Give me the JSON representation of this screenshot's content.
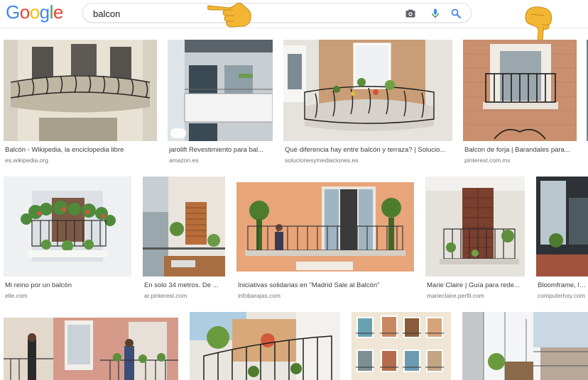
{
  "header": {
    "logo_letters": [
      {
        "ch": "G",
        "color": "#4285F4"
      },
      {
        "ch": "o",
        "color": "#EA4335"
      },
      {
        "ch": "o",
        "color": "#FBBC05"
      },
      {
        "ch": "g",
        "color": "#4285F4"
      },
      {
        "ch": "l",
        "color": "#34A853"
      },
      {
        "ch": "e",
        "color": "#EA4335"
      }
    ],
    "search": {
      "value": "balcon"
    },
    "icons": [
      "camera-icon",
      "microphone-icon",
      "search-icon"
    ]
  },
  "results": [
    {
      "title": "Balcón - Wikipedia, la enciclopedia libre",
      "site": "es.wikipedia.org"
    },
    {
      "title": "jarolift Revestimiento para bal...",
      "site": "amazon.es"
    },
    {
      "title": "Qué diferencia hay entre balcón y terraza? | Solucio...",
      "site": "solucionesymediaciones.es"
    },
    {
      "title": "Balcon de forja | Barandales para...",
      "site": "pinterest.com.mx"
    },
    {
      "title": "Mi reino por un balcón",
      "site": "elle.com"
    },
    {
      "title": "En solo 34 metros. De ...",
      "site": "ar.pinterest.com"
    },
    {
      "title": "Iniciativas solidarias en \"Madrid Sale al Balcón\"",
      "site": "infobarajas.com"
    },
    {
      "title": "Marie Claire | Guía para rede...",
      "site": "marieclaire.perfil.com"
    },
    {
      "title": "Bloomframe, la v",
      "site": "computerhoy.com"
    }
  ],
  "colors": {
    "accent": "#4285F4",
    "hand": "#F2B632"
  }
}
